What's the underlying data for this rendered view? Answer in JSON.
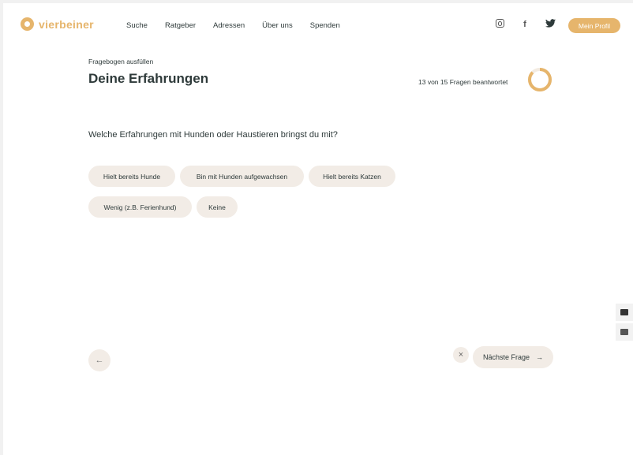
{
  "brand": {
    "name": "vierbeiner",
    "color": "#e6b56c"
  },
  "nav": {
    "items": [
      "Suche",
      "Ratgeber",
      "Adressen",
      "Über uns",
      "Spenden"
    ]
  },
  "social": {
    "instagram": "instagram-icon",
    "facebook": "f",
    "twitter": "twitter-icon"
  },
  "header": {
    "profile_label": "Mein Profil"
  },
  "form": {
    "eyebrow": "Fragebogen ausfüllen",
    "title": "Deine Erfahrungen",
    "progress_text": "13 von 15 Fragen beantwortet",
    "progress_fraction": 0.87,
    "question": "Welche Erfahrungen mit Hunden oder Haustieren bringst du mit?",
    "options": [
      "Hielt bereits Hunde",
      "Bin mit Hunden aufgewachsen",
      "Hielt bereits Katzen",
      "Wenig (z.B. Ferienhund)",
      "Keine"
    ],
    "back_arrow": "←",
    "skip_symbol": "×",
    "next_label": "Nächste Frage",
    "next_arrow": "→"
  }
}
